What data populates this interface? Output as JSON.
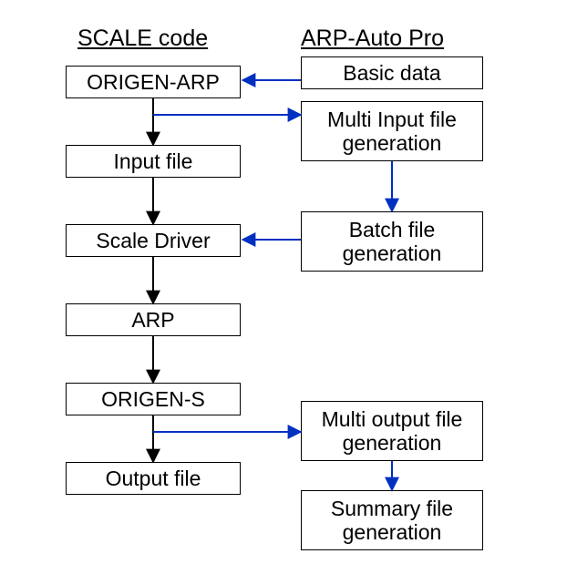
{
  "headers": {
    "left": "SCALE code",
    "right": "ARP-Auto Pro"
  },
  "left_boxes": {
    "origen_arp": "ORIGEN-ARP",
    "input_file": "Input file",
    "scale_driver": "Scale Driver",
    "arp": "ARP",
    "origen_s": "ORIGEN-S",
    "output_file": "Output file"
  },
  "right_boxes": {
    "basic_data": "Basic data",
    "multi_input": "Multi Input file\ngeneration",
    "batch_file": "Batch file\ngeneration",
    "multi_output": "Multi output file\ngeneration",
    "summary_file": "Summary file\ngeneration"
  }
}
